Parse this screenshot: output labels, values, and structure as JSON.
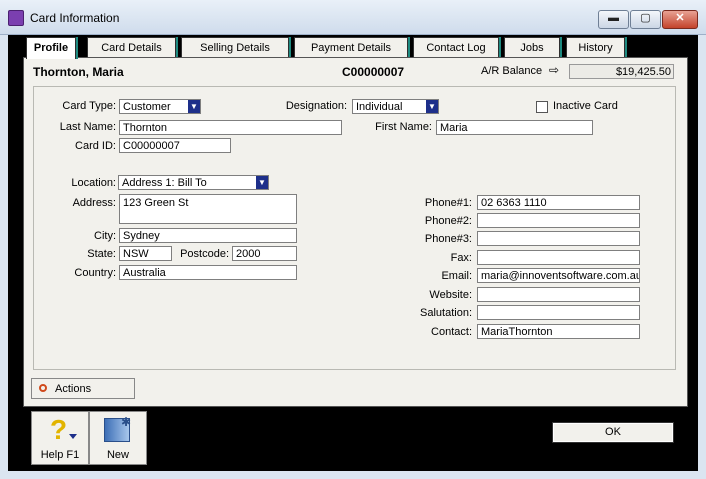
{
  "window": {
    "title": "Card Information",
    "minimize": "▬",
    "maximize": "▢",
    "close": "✕"
  },
  "tabs": [
    {
      "label": "Profile",
      "active": true
    },
    {
      "label": "Card Details"
    },
    {
      "label": "Selling Details"
    },
    {
      "label": "Payment Details"
    },
    {
      "label": "Contact Log"
    },
    {
      "label": "Jobs"
    },
    {
      "label": "History"
    }
  ],
  "header": {
    "name": "Thornton, Maria",
    "card_id": "C00000007",
    "ar_label": "A/R Balance",
    "ar_arrow": "⇨",
    "ar_value": "$19,425.50"
  },
  "profile": {
    "card_type_label": "Card Type:",
    "card_type_value": "Customer",
    "designation_label": "Designation:",
    "designation_value": "Individual",
    "inactive_label": "Inactive Card",
    "last_name_label": "Last Name:",
    "last_name_value": "Thornton",
    "first_name_label": "First Name:",
    "first_name_value": "Maria",
    "card_id_label": "Card ID:",
    "card_id_value": "C00000007"
  },
  "address": {
    "location_label": "Location:",
    "location_value": "Address 1:  Bill To",
    "address_label": "Address:",
    "address_value": "123 Green St",
    "city_label": "City:",
    "city_value": "Sydney",
    "state_label": "State:",
    "state_value": "NSW",
    "postcode_label": "Postcode:",
    "postcode_value": "2000",
    "country_label": "Country:",
    "country_value": "Australia"
  },
  "contact": {
    "phone1_label": "Phone#1:",
    "phone1_value": "02 6363 1110",
    "phone2_label": "Phone#2:",
    "phone2_value": "",
    "phone3_label": "Phone#3:",
    "phone3_value": "",
    "fax_label": "Fax:",
    "fax_value": "",
    "email_label": "Email:",
    "email_value": "maria@innoventsoftware.com.au",
    "website_label": "Website:",
    "website_value": "",
    "salutation_label": "Salutation:",
    "salutation_value": "",
    "contact_label": "Contact:",
    "contact_value": "MariaThornton"
  },
  "buttons": {
    "actions": "Actions",
    "help": "Help F1",
    "new": "New",
    "ok": "OK",
    "help_glyph": "?"
  }
}
